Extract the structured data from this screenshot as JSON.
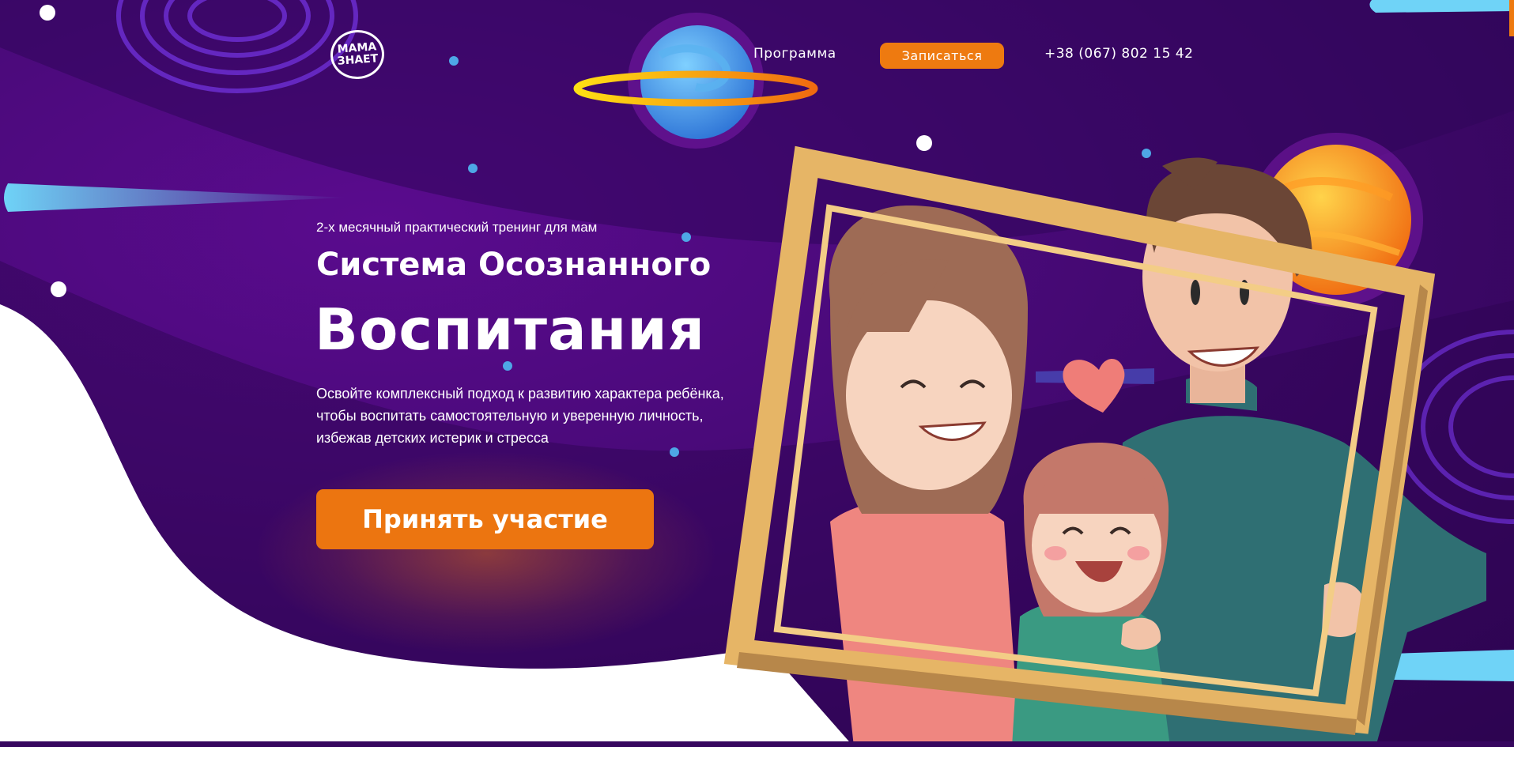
{
  "header": {
    "logo_line1": "МАМА",
    "logo_line2": "ЗНАЕТ",
    "nav_program": "Программа",
    "signup_button": "Записаться",
    "phone": "+38 (067) 802 15 42"
  },
  "hero": {
    "subtitle": "2-х месячный практический тренинг для мам",
    "title_line1": "Система Осознанного",
    "title_line2": "Воспитания",
    "description": "Освойте комплексный подход к развитию характера ребёнка, чтобы воспитать самостоятельную и уверенную личность, избежав детских истерик и стресса",
    "cta_button": "Принять участие"
  },
  "colors": {
    "background": "#3b0766",
    "accent": "#ec7510",
    "text": "#ffffff"
  },
  "icons": [
    "logo-icon",
    "planet-blue-icon",
    "planet-orange-icon",
    "heart-icon"
  ]
}
